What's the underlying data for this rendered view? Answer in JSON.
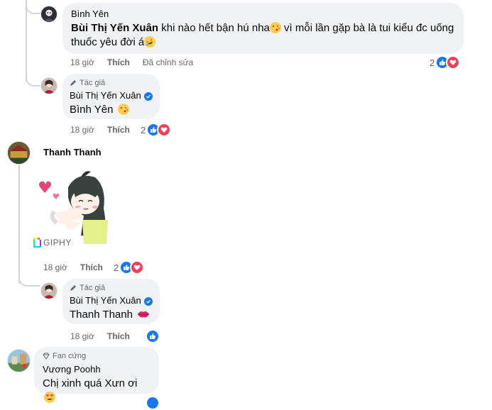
{
  "comments": [
    {
      "author": "Bình Yên",
      "mention": "Bùi Thị Yến Xuân",
      "text_part1": " khi nào hết bận hú nha",
      "text_part2": " vì mỗi lần gặp bà là tui kiểu đc uống",
      "text_line2": "thuốc yêu đời á",
      "time": "18 giờ",
      "like_label": "Thích",
      "edited_label": "Đã chỉnh sửa",
      "reaction_count": "2"
    },
    {
      "badge": "Tác giả",
      "author": "Bùi Thị Yến Xuân",
      "text": "Bình Yên",
      "time": "18 giờ",
      "like_label": "Thích",
      "reaction_count": "2"
    },
    {
      "author": "Thanh Thanh",
      "gif_label": "GIPHY",
      "time": "18 giờ",
      "like_label": "Thích",
      "reaction_count": "2"
    },
    {
      "badge": "Tác giả",
      "author": "Bùi Thị Yến Xuân",
      "text": "Thanh Thanh",
      "time": "18 giờ",
      "like_label": "Thích"
    },
    {
      "badge": "Fan cứng",
      "author": "Vương Poohh",
      "text": "Chị xinh quá Xưn ơi"
    }
  ],
  "colors": {
    "like": "#1877f2",
    "love": "#f33e58",
    "bubble": "#f0f2f5",
    "meta": "#65676b"
  },
  "icons": [
    "like-icon",
    "love-icon",
    "verified-icon",
    "pen-icon",
    "diamond-icon",
    "giphy-icon"
  ]
}
